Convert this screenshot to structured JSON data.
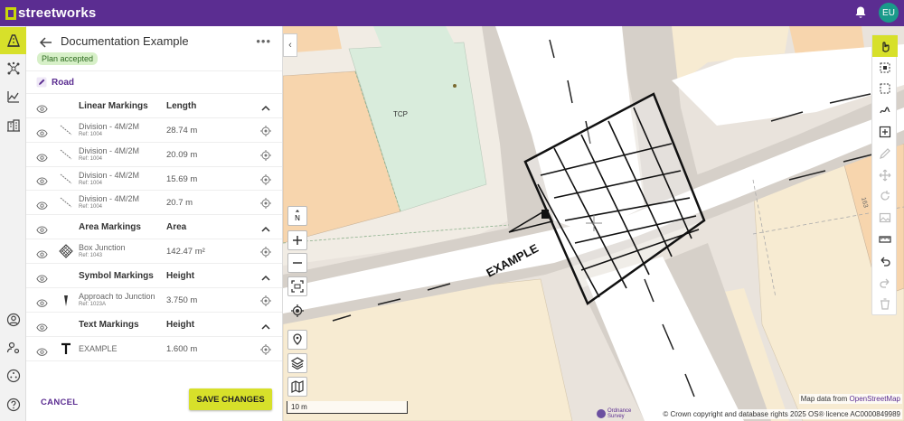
{
  "app": {
    "brand": "streetworks",
    "user_initials": "EU"
  },
  "panel": {
    "title": "Documentation Example",
    "status_badge": "Plan accepted",
    "category": "Road",
    "sections": [
      {
        "name": "Linear Markings",
        "column": "Length",
        "items": [
          {
            "name": "Division - 4M/2M",
            "ref": "Ref: 1004",
            "value": "28.74 m"
          },
          {
            "name": "Division - 4M/2M",
            "ref": "Ref: 1004",
            "value": "20.09 m"
          },
          {
            "name": "Division - 4M/2M",
            "ref": "Ref: 1004",
            "value": "15.69 m"
          },
          {
            "name": "Division - 4M/2M",
            "ref": "Ref: 1004",
            "value": "20.7 m"
          }
        ]
      },
      {
        "name": "Area Markings",
        "column": "Area",
        "items": [
          {
            "name": "Box Junction",
            "ref": "Ref: 1043",
            "value": "142.47 m²"
          }
        ]
      },
      {
        "name": "Symbol Markings",
        "column": "Height",
        "items": [
          {
            "name": "Approach to Junction",
            "ref": "Ref: 1023A",
            "value": "3.750 m"
          }
        ]
      },
      {
        "name": "Text Markings",
        "column": "Height",
        "items": [
          {
            "name": "EXAMPLE",
            "ref": "",
            "value": "1.600 m"
          }
        ]
      }
    ],
    "cancel_label": "CANCEL",
    "save_label": "SAVE CHANGES"
  },
  "map": {
    "north_label": "N",
    "building_label": "TCP",
    "road_text": "EXAMPLE",
    "house_number": "163",
    "scale_label": "10 m",
    "attribution_prefix": "Map data from ",
    "attribution_link": "OpenStreetMap",
    "copyright": "© Crown copyright and database rights 2025 OS® licence AC0000849989",
    "os_logo_line1": "Ordnance",
    "os_logo_line2": "Survey"
  },
  "colors": {
    "brand_purple": "#5b2d91",
    "accent_lime": "#d7e02a"
  }
}
